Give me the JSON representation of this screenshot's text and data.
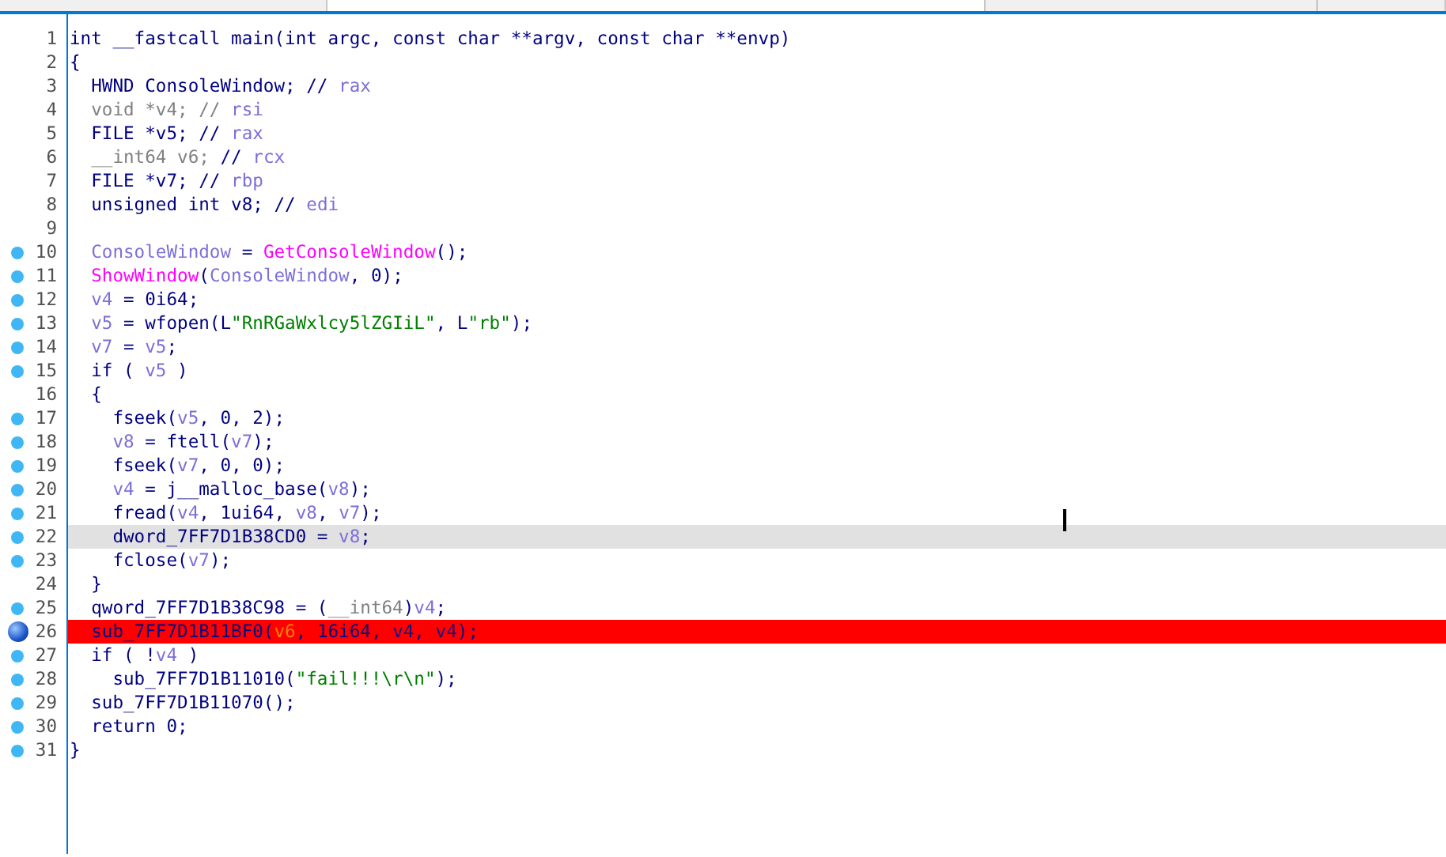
{
  "tabs": [
    {
      "selected": false
    },
    {
      "selected": true
    },
    {
      "selected": false
    },
    {
      "selected": false
    }
  ],
  "lines": [
    {
      "number": "1",
      "executable": false,
      "breakpoint": false,
      "current": false,
      "tokens": [
        {
          "kind": "code",
          "text": "int __fastcall main(int argc, const char **argv, const char **envp)"
        }
      ]
    },
    {
      "number": "2",
      "executable": false,
      "breakpoint": false,
      "current": false,
      "tokens": [
        {
          "kind": "code",
          "text": "{"
        }
      ]
    },
    {
      "number": "3",
      "executable": false,
      "breakpoint": false,
      "current": false,
      "tokens": [
        {
          "kind": "code",
          "text": "  HWND ConsoleWindow; // "
        },
        {
          "kind": "reg",
          "text": "rax"
        }
      ]
    },
    {
      "number": "4",
      "executable": false,
      "breakpoint": false,
      "current": false,
      "tokens": [
        {
          "kind": "unused",
          "text": "  void *v4; // "
        },
        {
          "kind": "reg",
          "text": "rsi"
        }
      ]
    },
    {
      "number": "5",
      "executable": false,
      "breakpoint": false,
      "current": false,
      "tokens": [
        {
          "kind": "code",
          "text": "  FILE *v5; // "
        },
        {
          "kind": "reg",
          "text": "rax"
        }
      ]
    },
    {
      "number": "6",
      "executable": false,
      "breakpoint": false,
      "current": false,
      "tokens": [
        {
          "kind": "unused",
          "text": "  __int64 v6;"
        },
        {
          "kind": "code",
          "text": " // "
        },
        {
          "kind": "reg",
          "text": "rcx"
        }
      ]
    },
    {
      "number": "7",
      "executable": false,
      "breakpoint": false,
      "current": false,
      "tokens": [
        {
          "kind": "code",
          "text": "  FILE *v7; // "
        },
        {
          "kind": "reg",
          "text": "rbp"
        }
      ]
    },
    {
      "number": "8",
      "executable": false,
      "breakpoint": false,
      "current": false,
      "tokens": [
        {
          "kind": "code",
          "text": "  unsigned int v8; // "
        },
        {
          "kind": "reg",
          "text": "edi"
        }
      ]
    },
    {
      "number": "9",
      "executable": false,
      "breakpoint": false,
      "current": false
    },
    {
      "number": "10",
      "executable": true,
      "breakpoint": false,
      "current": false,
      "tokens": [
        {
          "kind": "local",
          "text": "  ConsoleWindow"
        },
        {
          "kind": "code",
          "text": " = "
        },
        {
          "kind": "import",
          "text": "GetConsoleWindow"
        },
        {
          "kind": "code",
          "text": "();"
        }
      ]
    },
    {
      "number": "11",
      "executable": true,
      "breakpoint": false,
      "current": false,
      "tokens": [
        {
          "kind": "import",
          "text": "  ShowWindow"
        },
        {
          "kind": "code",
          "text": "("
        },
        {
          "kind": "local",
          "text": "ConsoleWindow"
        },
        {
          "kind": "code",
          "text": ", 0);"
        }
      ]
    },
    {
      "number": "12",
      "executable": true,
      "breakpoint": false,
      "current": false,
      "tokens": [
        {
          "kind": "local",
          "text": "  v4"
        },
        {
          "kind": "code",
          "text": " = 0i64;"
        }
      ]
    },
    {
      "number": "13",
      "executable": true,
      "breakpoint": false,
      "current": false,
      "tokens": [
        {
          "kind": "local",
          "text": "  v5"
        },
        {
          "kind": "code",
          "text": " = wfopen(L"
        },
        {
          "kind": "string",
          "text": "\"RnRGaWxlcy5lZGIiL\""
        },
        {
          "kind": "code",
          "text": ", L"
        },
        {
          "kind": "string",
          "text": "\"rb\""
        },
        {
          "kind": "code",
          "text": ");"
        }
      ]
    },
    {
      "number": "14",
      "executable": true,
      "breakpoint": false,
      "current": false,
      "tokens": [
        {
          "kind": "local",
          "text": "  v7"
        },
        {
          "kind": "code",
          "text": " = "
        },
        {
          "kind": "local",
          "text": "v5"
        },
        {
          "kind": "code",
          "text": ";"
        }
      ]
    },
    {
      "number": "15",
      "executable": true,
      "breakpoint": false,
      "current": false,
      "tokens": [
        {
          "kind": "code",
          "text": "  if ( "
        },
        {
          "kind": "local",
          "text": "v5"
        },
        {
          "kind": "code",
          "text": " )"
        }
      ]
    },
    {
      "number": "16",
      "executable": false,
      "breakpoint": false,
      "current": false,
      "tokens": [
        {
          "kind": "code",
          "text": "  {"
        }
      ]
    },
    {
      "number": "17",
      "executable": true,
      "breakpoint": false,
      "current": false,
      "tokens": [
        {
          "kind": "code",
          "text": "    fseek("
        },
        {
          "kind": "local",
          "text": "v5"
        },
        {
          "kind": "code",
          "text": ", 0, 2);"
        }
      ]
    },
    {
      "number": "18",
      "executable": true,
      "breakpoint": false,
      "current": false,
      "tokens": [
        {
          "kind": "local",
          "text": "    v8"
        },
        {
          "kind": "code",
          "text": " = ftell("
        },
        {
          "kind": "local",
          "text": "v7"
        },
        {
          "kind": "code",
          "text": ");"
        }
      ]
    },
    {
      "number": "19",
      "executable": true,
      "breakpoint": false,
      "current": false,
      "tokens": [
        {
          "kind": "code",
          "text": "    fseek("
        },
        {
          "kind": "local",
          "text": "v7"
        },
        {
          "kind": "code",
          "text": ", 0, 0);"
        }
      ]
    },
    {
      "number": "20",
      "executable": true,
      "breakpoint": false,
      "current": false,
      "tokens": [
        {
          "kind": "local",
          "text": "    v4"
        },
        {
          "kind": "code",
          "text": " = j__malloc_base("
        },
        {
          "kind": "local",
          "text": "v8"
        },
        {
          "kind": "code",
          "text": ");"
        }
      ]
    },
    {
      "number": "21",
      "executable": true,
      "breakpoint": false,
      "current": false,
      "tokens": [
        {
          "kind": "code",
          "text": "    fread("
        },
        {
          "kind": "local",
          "text": "v4"
        },
        {
          "kind": "code",
          "text": ", 1ui64, "
        },
        {
          "kind": "local",
          "text": "v8"
        },
        {
          "kind": "code",
          "text": ", "
        },
        {
          "kind": "local",
          "text": "v7"
        },
        {
          "kind": "code",
          "text": ");"
        }
      ]
    },
    {
      "number": "22",
      "executable": true,
      "breakpoint": false,
      "current": true,
      "tokens": [
        {
          "kind": "code",
          "text": "    dword_7FF7D1B38CD0 = "
        },
        {
          "kind": "local",
          "text": "v8"
        },
        {
          "kind": "code",
          "text": ";"
        }
      ]
    },
    {
      "number": "23",
      "executable": true,
      "breakpoint": false,
      "current": false,
      "tokens": [
        {
          "kind": "code",
          "text": "    fclose("
        },
        {
          "kind": "local",
          "text": "v7"
        },
        {
          "kind": "code",
          "text": ");"
        }
      ]
    },
    {
      "number": "24",
      "executable": false,
      "breakpoint": false,
      "current": false,
      "tokens": [
        {
          "kind": "code",
          "text": "  }"
        }
      ]
    },
    {
      "number": "25",
      "executable": true,
      "breakpoint": false,
      "current": false,
      "tokens": [
        {
          "kind": "code",
          "text": "  qword_7FF7D1B38C98 = ("
        },
        {
          "kind": "unused",
          "text": "__int64"
        },
        {
          "kind": "code",
          "text": ")"
        },
        {
          "kind": "local",
          "text": "v4"
        },
        {
          "kind": "code",
          "text": ";"
        }
      ]
    },
    {
      "number": "26",
      "executable": true,
      "breakpoint": true,
      "current": false,
      "tokens": [
        {
          "kind": "code",
          "text": "  sub_7FF7D1B11BF0("
        },
        {
          "kind": "uninit",
          "text": "v6"
        },
        {
          "kind": "code",
          "text": ", 16i64, "
        },
        {
          "kind": "local",
          "text": "v4"
        },
        {
          "kind": "code",
          "text": ", "
        },
        {
          "kind": "local",
          "text": "v4"
        },
        {
          "kind": "code",
          "text": ");"
        }
      ]
    },
    {
      "number": "27",
      "executable": true,
      "breakpoint": false,
      "current": false,
      "tokens": [
        {
          "kind": "code",
          "text": "  if ( !"
        },
        {
          "kind": "local",
          "text": "v4"
        },
        {
          "kind": "code",
          "text": " )"
        }
      ]
    },
    {
      "number": "28",
      "executable": true,
      "breakpoint": false,
      "current": false,
      "tokens": [
        {
          "kind": "code",
          "text": "    sub_7FF7D1B11010("
        },
        {
          "kind": "string",
          "text": "\"fail!!!\\r\\n\""
        },
        {
          "kind": "code",
          "text": ");"
        }
      ]
    },
    {
      "number": "29",
      "executable": true,
      "breakpoint": false,
      "current": false,
      "tokens": [
        {
          "kind": "code",
          "text": "  sub_7FF7D1B11070();"
        }
      ]
    },
    {
      "number": "30",
      "executable": true,
      "breakpoint": false,
      "current": false,
      "tokens": [
        {
          "kind": "code",
          "text": "  return 0;"
        }
      ]
    },
    {
      "number": "31",
      "executable": true,
      "breakpoint": false,
      "current": false,
      "tokens": [
        {
          "kind": "code",
          "text": "}"
        }
      ]
    }
  ]
}
